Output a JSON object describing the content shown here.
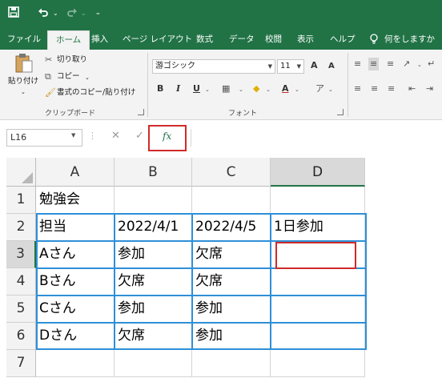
{
  "quick_access": {
    "save_icon": "save-icon",
    "undo_icon": "undo-icon",
    "redo_icon": "redo-icon",
    "customize_icon": "customize-icon"
  },
  "tabs": [
    "ファイル",
    "ホーム",
    "挿入",
    "ページ レイアウト",
    "数式",
    "データ",
    "校閲",
    "表示",
    "ヘルプ"
  ],
  "active_tab": "ホーム",
  "tell_me": "何をしますか",
  "clipboard": {
    "paste_label": "貼り付け",
    "cut_label": "切り取り",
    "copy_label": "コピー",
    "format_painter_label": "書式のコピー/貼り付け",
    "group_label": "クリップボード"
  },
  "font": {
    "font_name": "游ゴシック",
    "font_size": "11",
    "bold": "B",
    "italic": "I",
    "underline": "U",
    "grow": "A",
    "shrink": "A",
    "group_label": "フォント"
  },
  "formula_bar": {
    "name_box": "L16",
    "fx_label": "fx",
    "formula": ""
  },
  "sheet": {
    "columns": [
      "A",
      "B",
      "C",
      "D"
    ],
    "selected_column": "D",
    "rows": [
      "1",
      "2",
      "3",
      "4",
      "5",
      "6",
      "7"
    ],
    "selected_row": "3",
    "cells": [
      [
        "勉強会",
        "",
        "",
        ""
      ],
      [
        "担当",
        "2022/4/1",
        "2022/4/5",
        "1日参加"
      ],
      [
        "Aさん",
        "参加",
        "欠席",
        ""
      ],
      [
        "Bさん",
        "欠席",
        "欠席",
        ""
      ],
      [
        "Cさん",
        "参加",
        "参加",
        ""
      ],
      [
        "Dさん",
        "欠席",
        "参加",
        ""
      ],
      [
        "",
        "",
        "",
        ""
      ]
    ]
  },
  "colors": {
    "excel_green": "#217346",
    "table_border": "#2e8fd8",
    "highlight_red": "#d12a2a"
  }
}
